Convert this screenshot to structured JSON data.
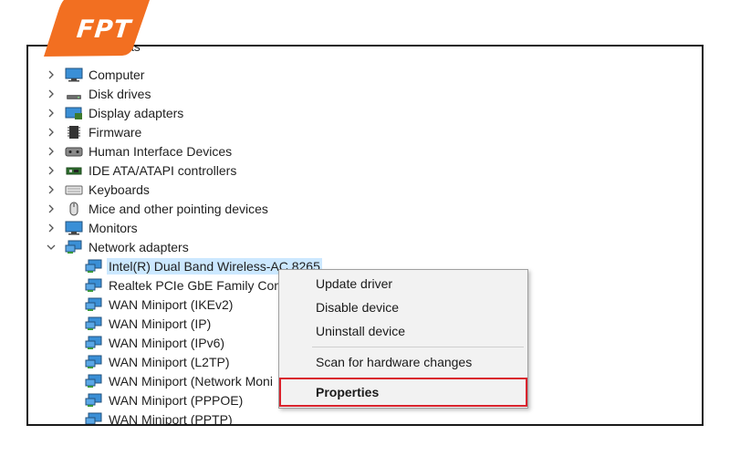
{
  "brand": {
    "name": "FPT",
    "badge_color": "#f26f21"
  },
  "tree": {
    "partial_top_label": "Cameras",
    "categories": [
      {
        "label": "Computer",
        "icon": "computer-icon",
        "expanded": false
      },
      {
        "label": "Disk drives",
        "icon": "disk-drive-icon",
        "expanded": false
      },
      {
        "label": "Display adapters",
        "icon": "display-adapter-icon",
        "expanded": false
      },
      {
        "label": "Firmware",
        "icon": "firmware-icon",
        "expanded": false
      },
      {
        "label": "Human Interface Devices",
        "icon": "hid-icon",
        "expanded": false
      },
      {
        "label": "IDE ATA/ATAPI controllers",
        "icon": "ide-controller-icon",
        "expanded": false
      },
      {
        "label": "Keyboards",
        "icon": "keyboard-icon",
        "expanded": false
      },
      {
        "label": "Mice and other pointing devices",
        "icon": "mouse-icon",
        "expanded": false
      },
      {
        "label": "Monitors",
        "icon": "monitor-icon",
        "expanded": false
      },
      {
        "label": "Network adapters",
        "icon": "network-adapter-icon",
        "expanded": true
      }
    ],
    "network_children": [
      {
        "label": "Intel(R) Dual Band Wireless-AC 8265",
        "selected": true
      },
      {
        "label": "Realtek PCIe GbE Family Contr"
      },
      {
        "label": "WAN Miniport (IKEv2)"
      },
      {
        "label": "WAN Miniport (IP)"
      },
      {
        "label": "WAN Miniport (IPv6)"
      },
      {
        "label": "WAN Miniport (L2TP)"
      },
      {
        "label": "WAN Miniport (Network Moni"
      },
      {
        "label": "WAN Miniport (PPPOE)"
      },
      {
        "label": "WAN Miniport (PPTP)"
      }
    ],
    "selection_color": "#cce8ff"
  },
  "context_menu": {
    "items": [
      {
        "label": "Update driver"
      },
      {
        "label": "Disable device"
      },
      {
        "label": "Uninstall device"
      },
      {
        "label": "Scan for hardware changes"
      },
      {
        "label": "Properties",
        "highlighted": true
      }
    ],
    "highlight_color": "#d9232d"
  }
}
